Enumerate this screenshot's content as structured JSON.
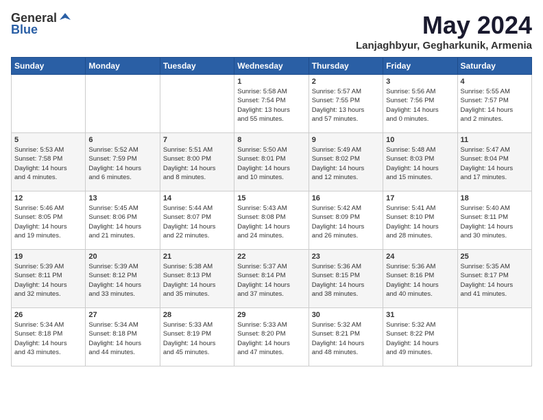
{
  "logo": {
    "general": "General",
    "blue": "Blue"
  },
  "title": {
    "month_year": "May 2024",
    "location": "Lanjaghbyur, Gegharkunik, Armenia"
  },
  "days_of_week": [
    "Sunday",
    "Monday",
    "Tuesday",
    "Wednesday",
    "Thursday",
    "Friday",
    "Saturday"
  ],
  "weeks": [
    [
      {
        "day": "",
        "info": ""
      },
      {
        "day": "",
        "info": ""
      },
      {
        "day": "",
        "info": ""
      },
      {
        "day": "1",
        "info": "Sunrise: 5:58 AM\nSunset: 7:54 PM\nDaylight: 13 hours\nand 55 minutes."
      },
      {
        "day": "2",
        "info": "Sunrise: 5:57 AM\nSunset: 7:55 PM\nDaylight: 13 hours\nand 57 minutes."
      },
      {
        "day": "3",
        "info": "Sunrise: 5:56 AM\nSunset: 7:56 PM\nDaylight: 14 hours\nand 0 minutes."
      },
      {
        "day": "4",
        "info": "Sunrise: 5:55 AM\nSunset: 7:57 PM\nDaylight: 14 hours\nand 2 minutes."
      }
    ],
    [
      {
        "day": "5",
        "info": "Sunrise: 5:53 AM\nSunset: 7:58 PM\nDaylight: 14 hours\nand 4 minutes."
      },
      {
        "day": "6",
        "info": "Sunrise: 5:52 AM\nSunset: 7:59 PM\nDaylight: 14 hours\nand 6 minutes."
      },
      {
        "day": "7",
        "info": "Sunrise: 5:51 AM\nSunset: 8:00 PM\nDaylight: 14 hours\nand 8 minutes."
      },
      {
        "day": "8",
        "info": "Sunrise: 5:50 AM\nSunset: 8:01 PM\nDaylight: 14 hours\nand 10 minutes."
      },
      {
        "day": "9",
        "info": "Sunrise: 5:49 AM\nSunset: 8:02 PM\nDaylight: 14 hours\nand 12 minutes."
      },
      {
        "day": "10",
        "info": "Sunrise: 5:48 AM\nSunset: 8:03 PM\nDaylight: 14 hours\nand 15 minutes."
      },
      {
        "day": "11",
        "info": "Sunrise: 5:47 AM\nSunset: 8:04 PM\nDaylight: 14 hours\nand 17 minutes."
      }
    ],
    [
      {
        "day": "12",
        "info": "Sunrise: 5:46 AM\nSunset: 8:05 PM\nDaylight: 14 hours\nand 19 minutes."
      },
      {
        "day": "13",
        "info": "Sunrise: 5:45 AM\nSunset: 8:06 PM\nDaylight: 14 hours\nand 21 minutes."
      },
      {
        "day": "14",
        "info": "Sunrise: 5:44 AM\nSunset: 8:07 PM\nDaylight: 14 hours\nand 22 minutes."
      },
      {
        "day": "15",
        "info": "Sunrise: 5:43 AM\nSunset: 8:08 PM\nDaylight: 14 hours\nand 24 minutes."
      },
      {
        "day": "16",
        "info": "Sunrise: 5:42 AM\nSunset: 8:09 PM\nDaylight: 14 hours\nand 26 minutes."
      },
      {
        "day": "17",
        "info": "Sunrise: 5:41 AM\nSunset: 8:10 PM\nDaylight: 14 hours\nand 28 minutes."
      },
      {
        "day": "18",
        "info": "Sunrise: 5:40 AM\nSunset: 8:11 PM\nDaylight: 14 hours\nand 30 minutes."
      }
    ],
    [
      {
        "day": "19",
        "info": "Sunrise: 5:39 AM\nSunset: 8:11 PM\nDaylight: 14 hours\nand 32 minutes."
      },
      {
        "day": "20",
        "info": "Sunrise: 5:39 AM\nSunset: 8:12 PM\nDaylight: 14 hours\nand 33 minutes."
      },
      {
        "day": "21",
        "info": "Sunrise: 5:38 AM\nSunset: 8:13 PM\nDaylight: 14 hours\nand 35 minutes."
      },
      {
        "day": "22",
        "info": "Sunrise: 5:37 AM\nSunset: 8:14 PM\nDaylight: 14 hours\nand 37 minutes."
      },
      {
        "day": "23",
        "info": "Sunrise: 5:36 AM\nSunset: 8:15 PM\nDaylight: 14 hours\nand 38 minutes."
      },
      {
        "day": "24",
        "info": "Sunrise: 5:36 AM\nSunset: 8:16 PM\nDaylight: 14 hours\nand 40 minutes."
      },
      {
        "day": "25",
        "info": "Sunrise: 5:35 AM\nSunset: 8:17 PM\nDaylight: 14 hours\nand 41 minutes."
      }
    ],
    [
      {
        "day": "26",
        "info": "Sunrise: 5:34 AM\nSunset: 8:18 PM\nDaylight: 14 hours\nand 43 minutes."
      },
      {
        "day": "27",
        "info": "Sunrise: 5:34 AM\nSunset: 8:18 PM\nDaylight: 14 hours\nand 44 minutes."
      },
      {
        "day": "28",
        "info": "Sunrise: 5:33 AM\nSunset: 8:19 PM\nDaylight: 14 hours\nand 45 minutes."
      },
      {
        "day": "29",
        "info": "Sunrise: 5:33 AM\nSunset: 8:20 PM\nDaylight: 14 hours\nand 47 minutes."
      },
      {
        "day": "30",
        "info": "Sunrise: 5:32 AM\nSunset: 8:21 PM\nDaylight: 14 hours\nand 48 minutes."
      },
      {
        "day": "31",
        "info": "Sunrise: 5:32 AM\nSunset: 8:22 PM\nDaylight: 14 hours\nand 49 minutes."
      },
      {
        "day": "",
        "info": ""
      }
    ]
  ]
}
